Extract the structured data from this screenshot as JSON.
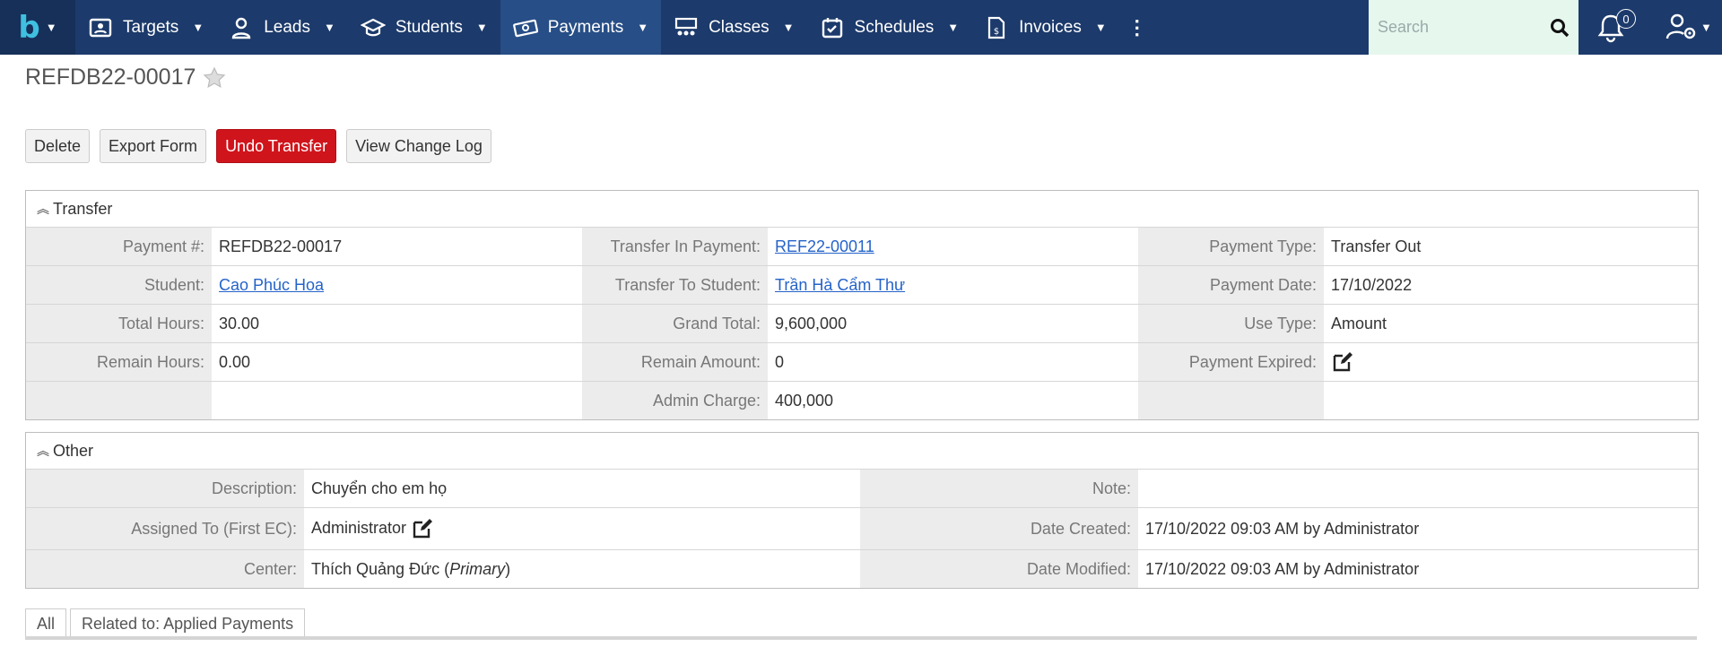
{
  "nav": {
    "items": [
      {
        "label": "Targets",
        "icon": "contact-card-icon"
      },
      {
        "label": "Leads",
        "icon": "user-badge-icon"
      },
      {
        "label": "Students",
        "icon": "graduation-cap-icon"
      },
      {
        "label": "Payments",
        "icon": "money-bill-icon"
      },
      {
        "label": "Classes",
        "icon": "classroom-icon"
      },
      {
        "label": "Schedules",
        "icon": "calendar-check-icon"
      },
      {
        "label": "Invoices",
        "icon": "invoice-icon"
      }
    ],
    "active": "Payments",
    "search_placeholder": "Search",
    "notification_count": "0"
  },
  "record": {
    "title": "REFDB22-00017"
  },
  "actions": {
    "delete": "Delete",
    "export": "Export Form",
    "undo": "Undo Transfer",
    "changelog": "View Change Log"
  },
  "transfer": {
    "header": "Transfer",
    "payment_no_label": "Payment #:",
    "payment_no": "REFDB22-00017",
    "transfer_in_label": "Transfer In Payment:",
    "transfer_in": "REF22-00011",
    "payment_type_label": "Payment Type:",
    "payment_type": "Transfer Out",
    "student_label": "Student:",
    "student": "Cao Phúc Hoa",
    "transfer_to_label": "Transfer To Student:",
    "transfer_to": "Trần Hà Cẩm Thư",
    "payment_date_label": "Payment Date:",
    "payment_date": "17/10/2022",
    "total_hours_label": "Total Hours:",
    "total_hours": "30.00",
    "grand_total_label": "Grand Total:",
    "grand_total": "9,600,000",
    "use_type_label": "Use Type:",
    "use_type": "Amount",
    "remain_hours_label": "Remain Hours:",
    "remain_hours": "0.00",
    "remain_amount_label": "Remain Amount:",
    "remain_amount": "0",
    "payment_expired_label": "Payment Expired:",
    "admin_charge_label": "Admin Charge:",
    "admin_charge": "400,000"
  },
  "other": {
    "header": "Other",
    "description_label": "Description:",
    "description": "Chuyển cho em họ",
    "note_label": "Note:",
    "note": "",
    "assigned_label": "Assigned To (First EC):",
    "assigned": "Administrator",
    "date_created_label": "Date Created:",
    "date_created": "17/10/2022 09:03 AM by Administrator",
    "center_label": "Center:",
    "center": "Thích Quảng Đức (",
    "center_primary": "Primary",
    "center_close": ")",
    "date_modified_label": "Date Modified:",
    "date_modified": "17/10/2022 09:03 AM by Administrator"
  },
  "tabs": {
    "all": "All",
    "related": "Related to: Applied Payments"
  },
  "colors": {
    "nav": "#1c3a6b",
    "nav_active": "#274e86",
    "danger": "#d0141c",
    "link": "#2563c9"
  }
}
